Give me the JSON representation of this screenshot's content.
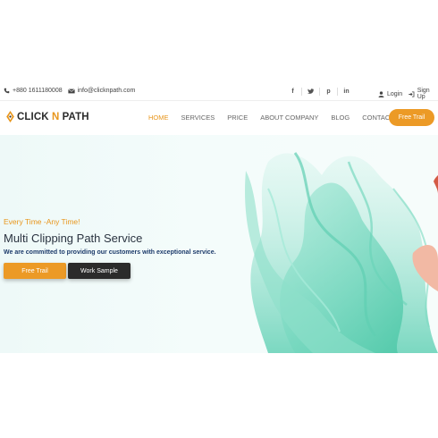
{
  "topbar": {
    "phone": "+880 1611180008",
    "email": "info@clicknpath.com",
    "social": [
      "f",
      "t",
      "p",
      "in"
    ],
    "login": "Login",
    "signup": "Sign Up"
  },
  "brand": {
    "part1": "CLICK ",
    "part2": "N",
    "part3": " PATH",
    "accent": "#e8961c"
  },
  "nav": {
    "items": [
      "HOME",
      "SERVICES",
      "PRICE",
      "ABOUT COMPANY",
      "BLOG",
      "CONTACT"
    ],
    "active": "HOME",
    "cta": "Free Trail"
  },
  "hero": {
    "tagline": "Every Time -Any Time!",
    "headline": "Multi Clipping Path Service",
    "subline": "We are committed to providing our customers with exceptional service.",
    "primary_button": "Free Trail",
    "secondary_button": "Work Sample",
    "fabric_color": "#7fdcc4"
  }
}
